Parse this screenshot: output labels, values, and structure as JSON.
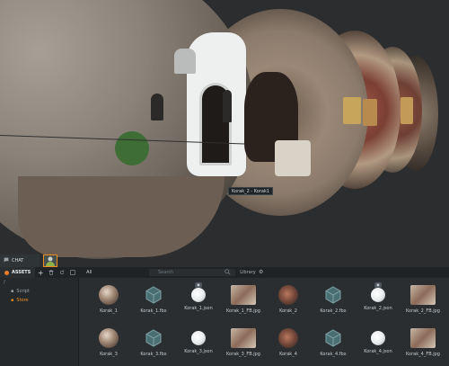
{
  "viewport": {
    "tooltip": "Korak_2 - Korak1"
  },
  "chat": {
    "tab_label": "CHAT"
  },
  "assets_panel": {
    "title": "ASSETS",
    "add_label": "+",
    "filter_label": "All",
    "search_placeholder": "Search",
    "library_label": "Library",
    "tree": [
      {
        "label": "/",
        "active": false
      },
      {
        "label": "Script",
        "active": false
      },
      {
        "label": "Store",
        "active": true
      }
    ],
    "items": [
      {
        "label": "Korak_1",
        "kind": "pano",
        "prefix": "○"
      },
      {
        "label": "Korak_1.fbx",
        "kind": "fbx"
      },
      {
        "label": "Korak_1.json",
        "kind": "json"
      },
      {
        "label": "Korak_1_FB.jpg",
        "kind": "image",
        "prefix": "○"
      },
      {
        "label": "Korak_2",
        "kind": "pano",
        "prefix": "○"
      },
      {
        "label": "Korak_2.fbx",
        "kind": "fbx"
      },
      {
        "label": "Korak_2.json",
        "kind": "json"
      },
      {
        "label": "Korak_2_FB.jpg",
        "kind": "image",
        "prefix": "○"
      },
      {
        "label": "Korak_3",
        "kind": "pano"
      },
      {
        "label": "Korak_3.fbx",
        "kind": "fbx"
      },
      {
        "label": "Korak_3.json",
        "kind": "json"
      },
      {
        "label": "Korak_3_FB.jpg",
        "kind": "image"
      },
      {
        "label": "Korak_4",
        "kind": "pano"
      },
      {
        "label": "Korak_4.fbx",
        "kind": "fbx"
      },
      {
        "label": "Korak_4.json",
        "kind": "json"
      },
      {
        "label": "Korak_4_FB.jpg",
        "kind": "image"
      }
    ]
  },
  "colors": {
    "accent": "#ec7b2a",
    "panel_bg": "#2a2e31"
  }
}
